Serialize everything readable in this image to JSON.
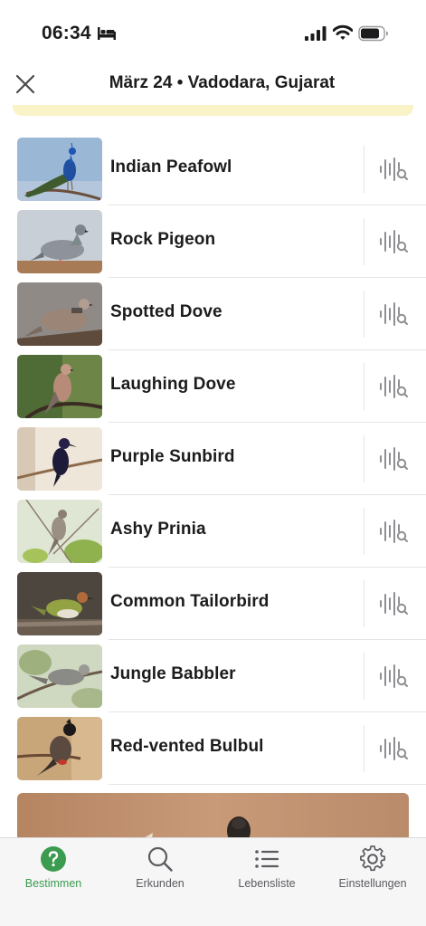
{
  "status_bar": {
    "time": "06:34",
    "icons": [
      "bed-icon",
      "signal-icon",
      "wifi-icon",
      "battery-icon"
    ]
  },
  "header": {
    "title": "März 24 • Vadodara, Gujarat",
    "close_icon": "close-icon"
  },
  "birds": [
    {
      "name": "Indian Peafowl"
    },
    {
      "name": "Rock Pigeon"
    },
    {
      "name": "Spotted Dove"
    },
    {
      "name": "Laughing Dove"
    },
    {
      "name": "Purple Sunbird"
    },
    {
      "name": "Ashy Prinia"
    },
    {
      "name": "Common Tailorbird"
    },
    {
      "name": "Jungle Babbler"
    },
    {
      "name": "Red-vented Bulbul"
    }
  ],
  "row_action_icon": "sound-id-icon",
  "tabs": [
    {
      "label": "Bestimmen",
      "icon": "help-circle-icon",
      "active": true
    },
    {
      "label": "Erkunden",
      "icon": "search-icon",
      "active": false
    },
    {
      "label": "Lebensliste",
      "icon": "list-icon",
      "active": false
    },
    {
      "label": "Einstellungen",
      "icon": "gear-icon",
      "active": false
    }
  ],
  "colors": {
    "accent": "#3b9b4f",
    "banner": "#fbf3c8",
    "text": "#1c1c1e",
    "tab_inactive": "#5b5b60"
  }
}
